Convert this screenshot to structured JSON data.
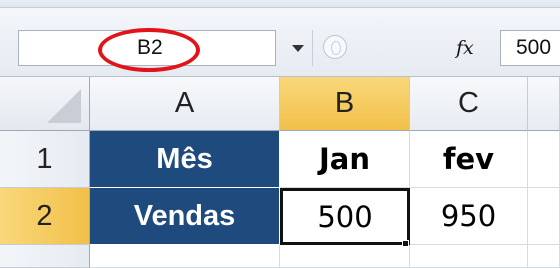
{
  "formula_bar": {
    "name_box": "B2",
    "fx_label": "fx",
    "formula_value": "500"
  },
  "columns": [
    "A",
    "B",
    "C",
    ""
  ],
  "rows": [
    "1",
    "2",
    ""
  ],
  "cells": {
    "A1": "Mês",
    "B1": "Jan",
    "C1": "fev",
    "D1": "",
    "A2": "Vendas",
    "B2": "500",
    "C2": "950",
    "D2": ""
  },
  "colors": {
    "label_fill": "#1f4a7d",
    "selection_header": "#f2c04a",
    "name_box_circle": "#e3131a"
  },
  "icons": [
    "dropdown-icon",
    "function-icon",
    "cancel-icon"
  ]
}
